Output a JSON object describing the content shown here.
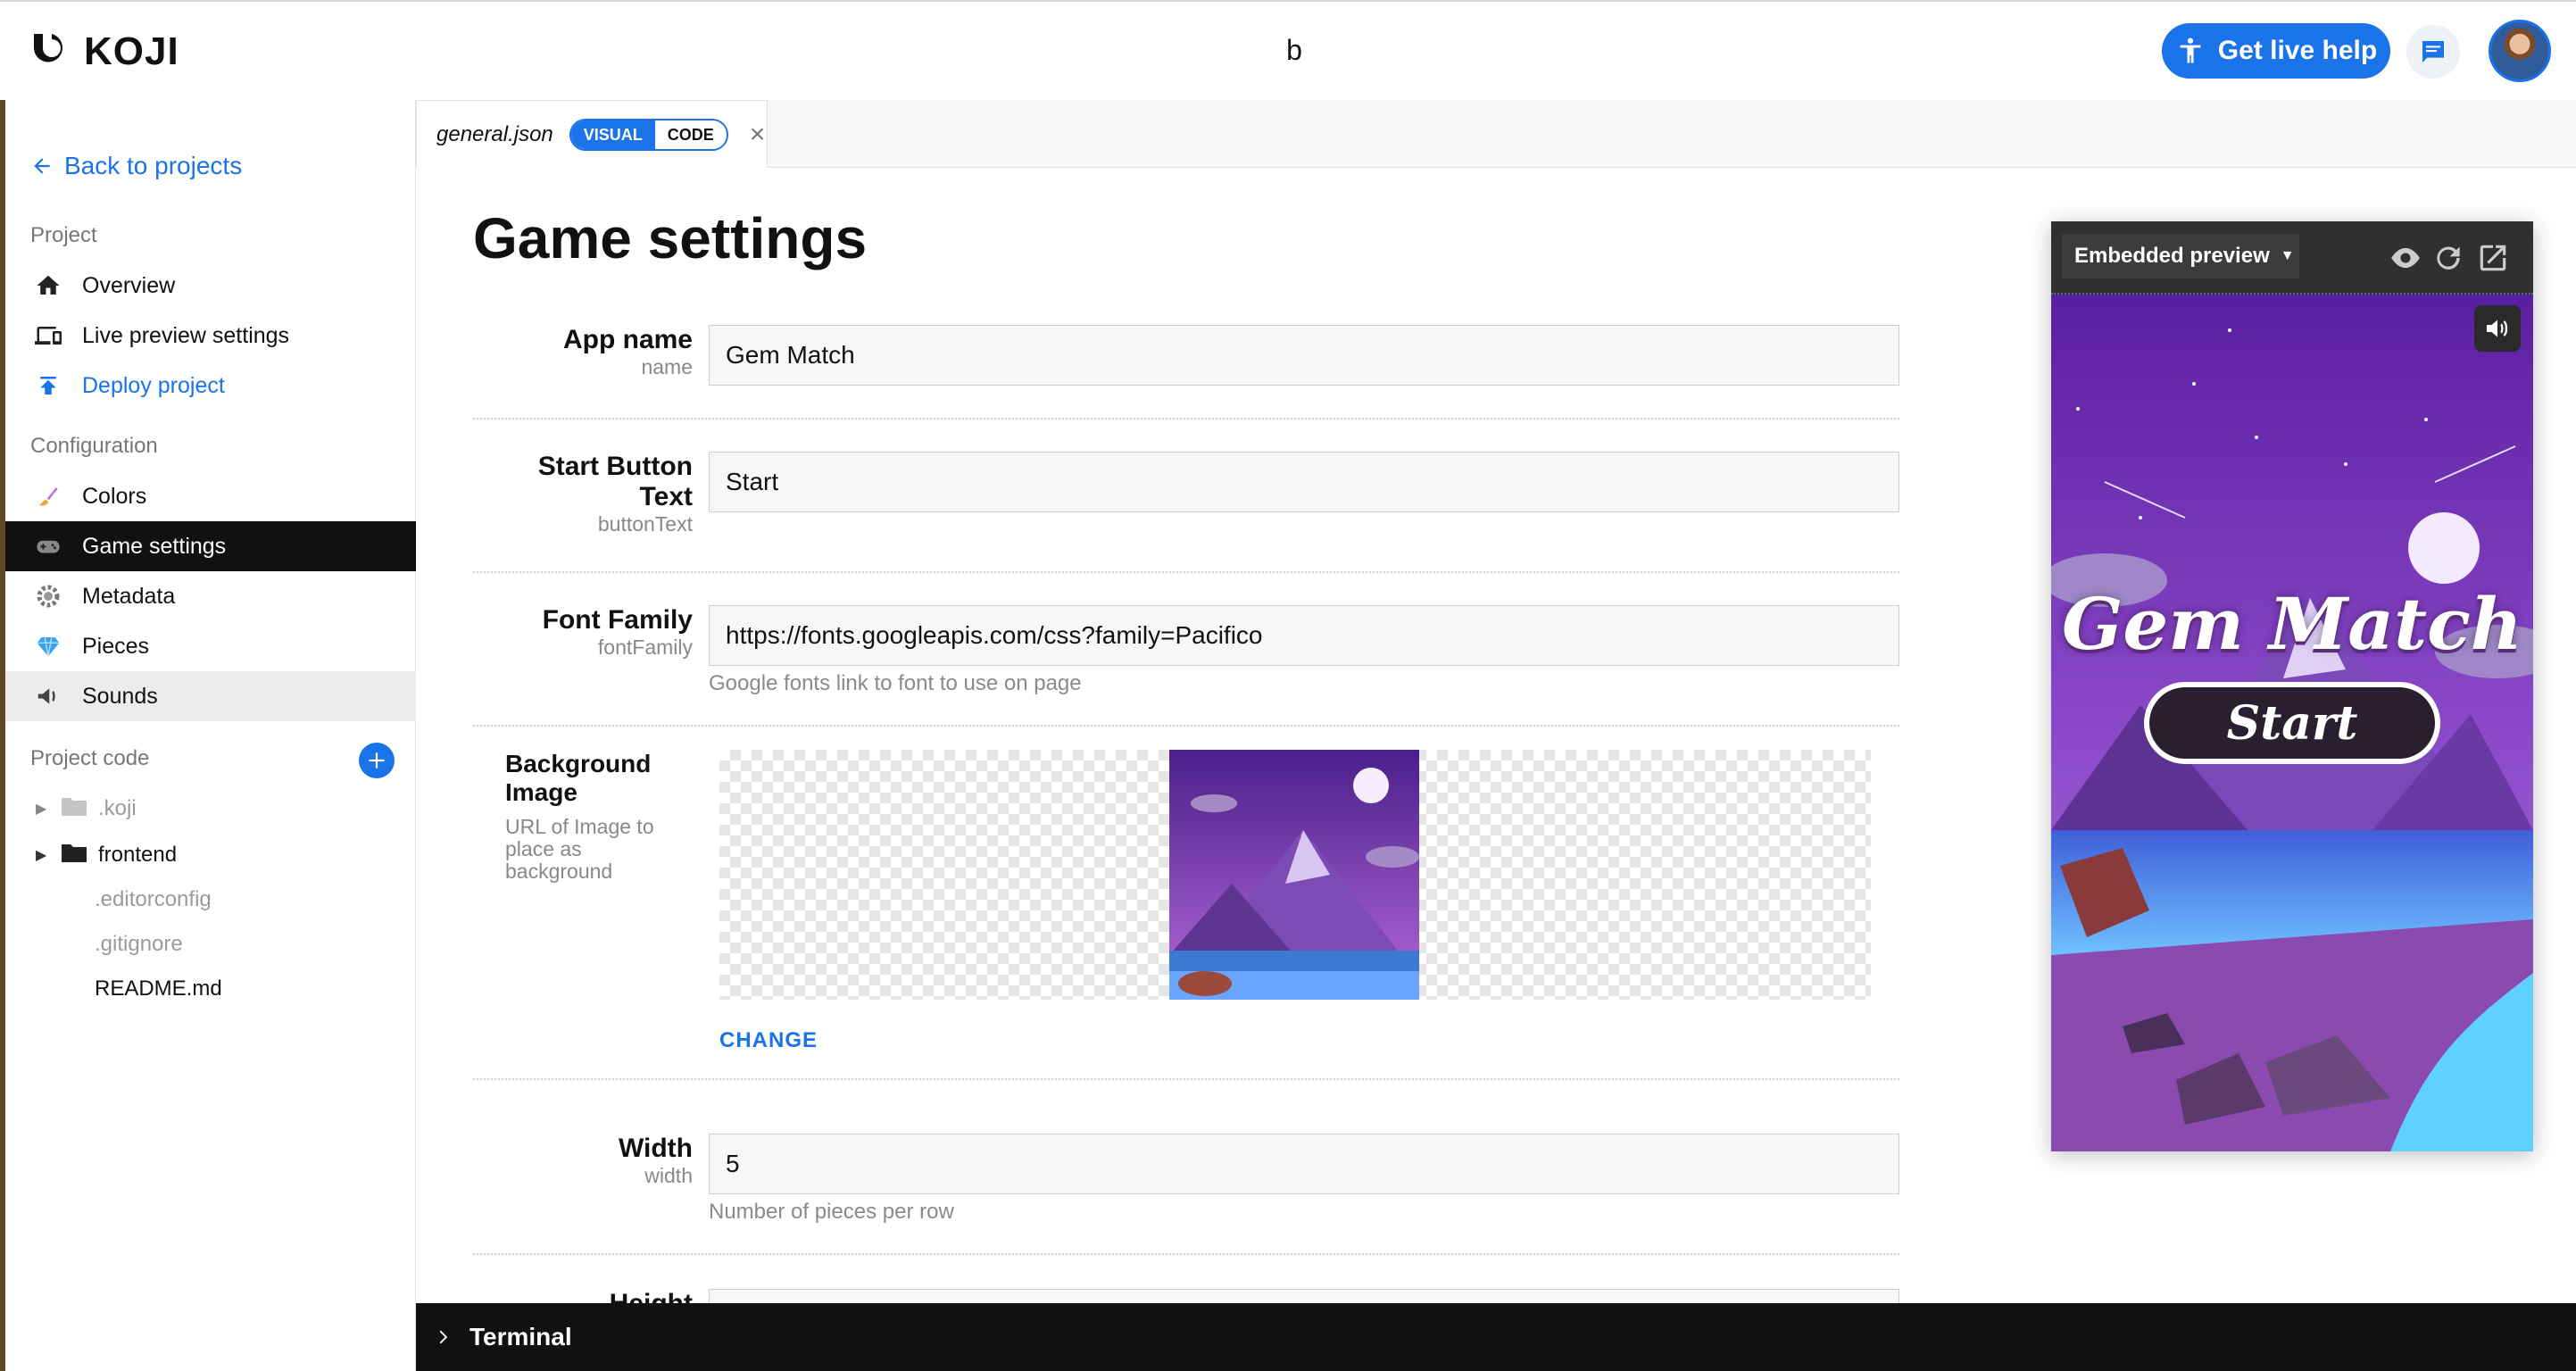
{
  "topbar": {
    "logo_text": "KOJI",
    "project_title": "b",
    "live_help_label": "Get live help"
  },
  "sidebar": {
    "back_label": "Back to projects",
    "project_heading": "Project",
    "project_items": [
      {
        "label": "Overview",
        "icon": "home-icon"
      },
      {
        "label": "Live preview settings",
        "icon": "devices-icon"
      },
      {
        "label": "Deploy project",
        "icon": "upload-icon"
      }
    ],
    "config_heading": "Configuration",
    "config_items": [
      {
        "label": "Colors",
        "icon": "palette-icon"
      },
      {
        "label": "Game settings",
        "icon": "gamepad-icon"
      },
      {
        "label": "Metadata",
        "icon": "gear-icon"
      },
      {
        "label": "Pieces",
        "icon": "gem-icon"
      },
      {
        "label": "Sounds",
        "icon": "speaker-icon"
      }
    ],
    "code_heading": "Project code",
    "tree": [
      {
        "label": ".koji"
      },
      {
        "label": "frontend"
      },
      {
        "label": ".editorconfig"
      },
      {
        "label": ".gitignore"
      },
      {
        "label": "README.md"
      }
    ]
  },
  "tab": {
    "file_name": "general.json",
    "mode_visual": "VISUAL",
    "mode_code": "CODE"
  },
  "editor": {
    "title": "Game settings",
    "fields": {
      "app_name": {
        "label": "App name",
        "key": "name",
        "value": "Gem Match"
      },
      "button_text": {
        "label": "Start Button Text",
        "key": "buttonText",
        "value": "Start"
      },
      "font_family": {
        "label": "Font Family",
        "key": "fontFamily",
        "value": "https://fonts.googleapis.com/css?family=Pacifico",
        "help": "Google fonts link to font to use on page"
      },
      "background": {
        "label": "Background Image",
        "key": "URL of Image to place as background",
        "change": "CHANGE"
      },
      "width": {
        "label": "Width",
        "key": "width",
        "value": "5",
        "help": "Number of pieces per row"
      },
      "height": {
        "label": "Height"
      }
    }
  },
  "preview": {
    "select_label": "Embedded preview",
    "game_title": "Gem Match",
    "start_label": "Start"
  },
  "terminal": {
    "label": "Terminal"
  },
  "colors": {
    "accent": "#1a73e8",
    "active_nav": "#111111",
    "terminal_bg": "#111111"
  }
}
